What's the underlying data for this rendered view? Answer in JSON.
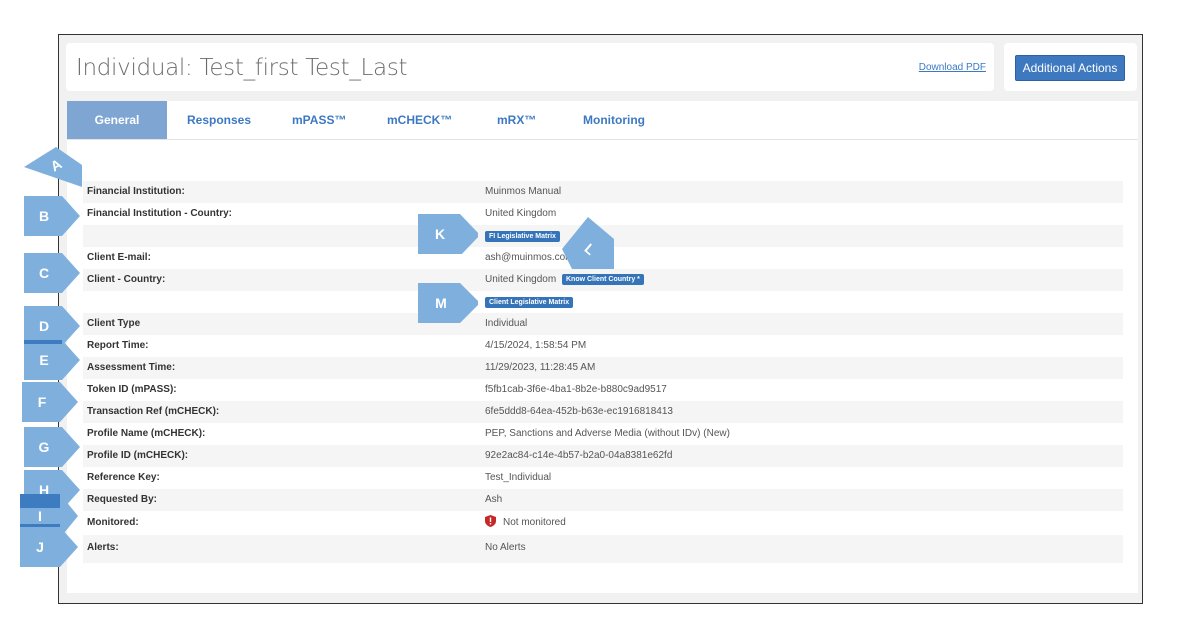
{
  "header": {
    "title": "Individual:  Test_first Test_Last",
    "download_pdf": "Download PDF",
    "additional_actions": "Additional Actions"
  },
  "tabs": [
    {
      "label": "General",
      "active": true
    },
    {
      "label": "Responses"
    },
    {
      "label": "mPASS™"
    },
    {
      "label": "mCHECK™"
    },
    {
      "label": "mRX™"
    },
    {
      "label": "Monitoring"
    }
  ],
  "fields": {
    "fi": {
      "label": "Financial Institution:",
      "value": "Muinmos Manual"
    },
    "fi_country": {
      "label": "Financial Institution - Country:",
      "value": "United Kingdom"
    },
    "fi_matrix": {
      "badge": "FI Legislative Matrix"
    },
    "email": {
      "label": "Client E-mail:",
      "value": "ash@muinmos.com"
    },
    "client_country": {
      "label": "Client - Country:",
      "value": "United Kingdom",
      "badge": "Know Client Country *"
    },
    "client_matrix": {
      "badge": "Client Legislative Matrix"
    },
    "client_type": {
      "label": "Client Type",
      "value": "Individual"
    },
    "report_time": {
      "label": "Report Time:",
      "value": "4/15/2024, 1:58:54 PM"
    },
    "assessment_time": {
      "label": "Assessment Time:",
      "value": "11/29/2023, 11:28:45 AM"
    },
    "token_id": {
      "label": "Token ID (mPASS):",
      "value": "f5fb1cab-3f6e-4ba1-8b2e-b880c9ad9517"
    },
    "transaction_ref": {
      "label": "Transaction Ref (mCHECK):",
      "value": "6fe5ddd8-64ea-452b-b63e-ec1916818413"
    },
    "profile_name": {
      "label": "Profile Name (mCHECK):",
      "value": "PEP, Sanctions and Adverse Media (without IDv) (New)"
    },
    "profile_id": {
      "label": "Profile ID (mCHECK):",
      "value": "92e2ac84-c14e-4b57-b2a0-04a8381e62fd"
    },
    "reference_key": {
      "label": "Reference Key:",
      "value": "Test_Individual"
    },
    "requested_by": {
      "label": "Requested By:",
      "value": "Ash"
    },
    "monitored": {
      "label": "Monitored:",
      "value": "Not monitored",
      "icon": "shield-alert-icon",
      "icon_color": "#c62828"
    },
    "alerts": {
      "label": "Alerts:",
      "value": "No Alerts"
    }
  },
  "callouts": {
    "a": "A",
    "b": "B",
    "c": "C",
    "d": "D",
    "e": "E",
    "f": "F",
    "g": "G",
    "h": "H",
    "i": "I",
    "j": "J",
    "k": "K",
    "l": "L",
    "m": "M",
    "color": "#7fb0dd"
  },
  "colors": {
    "accent": "#3e79bf",
    "tab_active": "#7fa6d3",
    "link": "#3d79c2",
    "badge": "#3574b8"
  }
}
